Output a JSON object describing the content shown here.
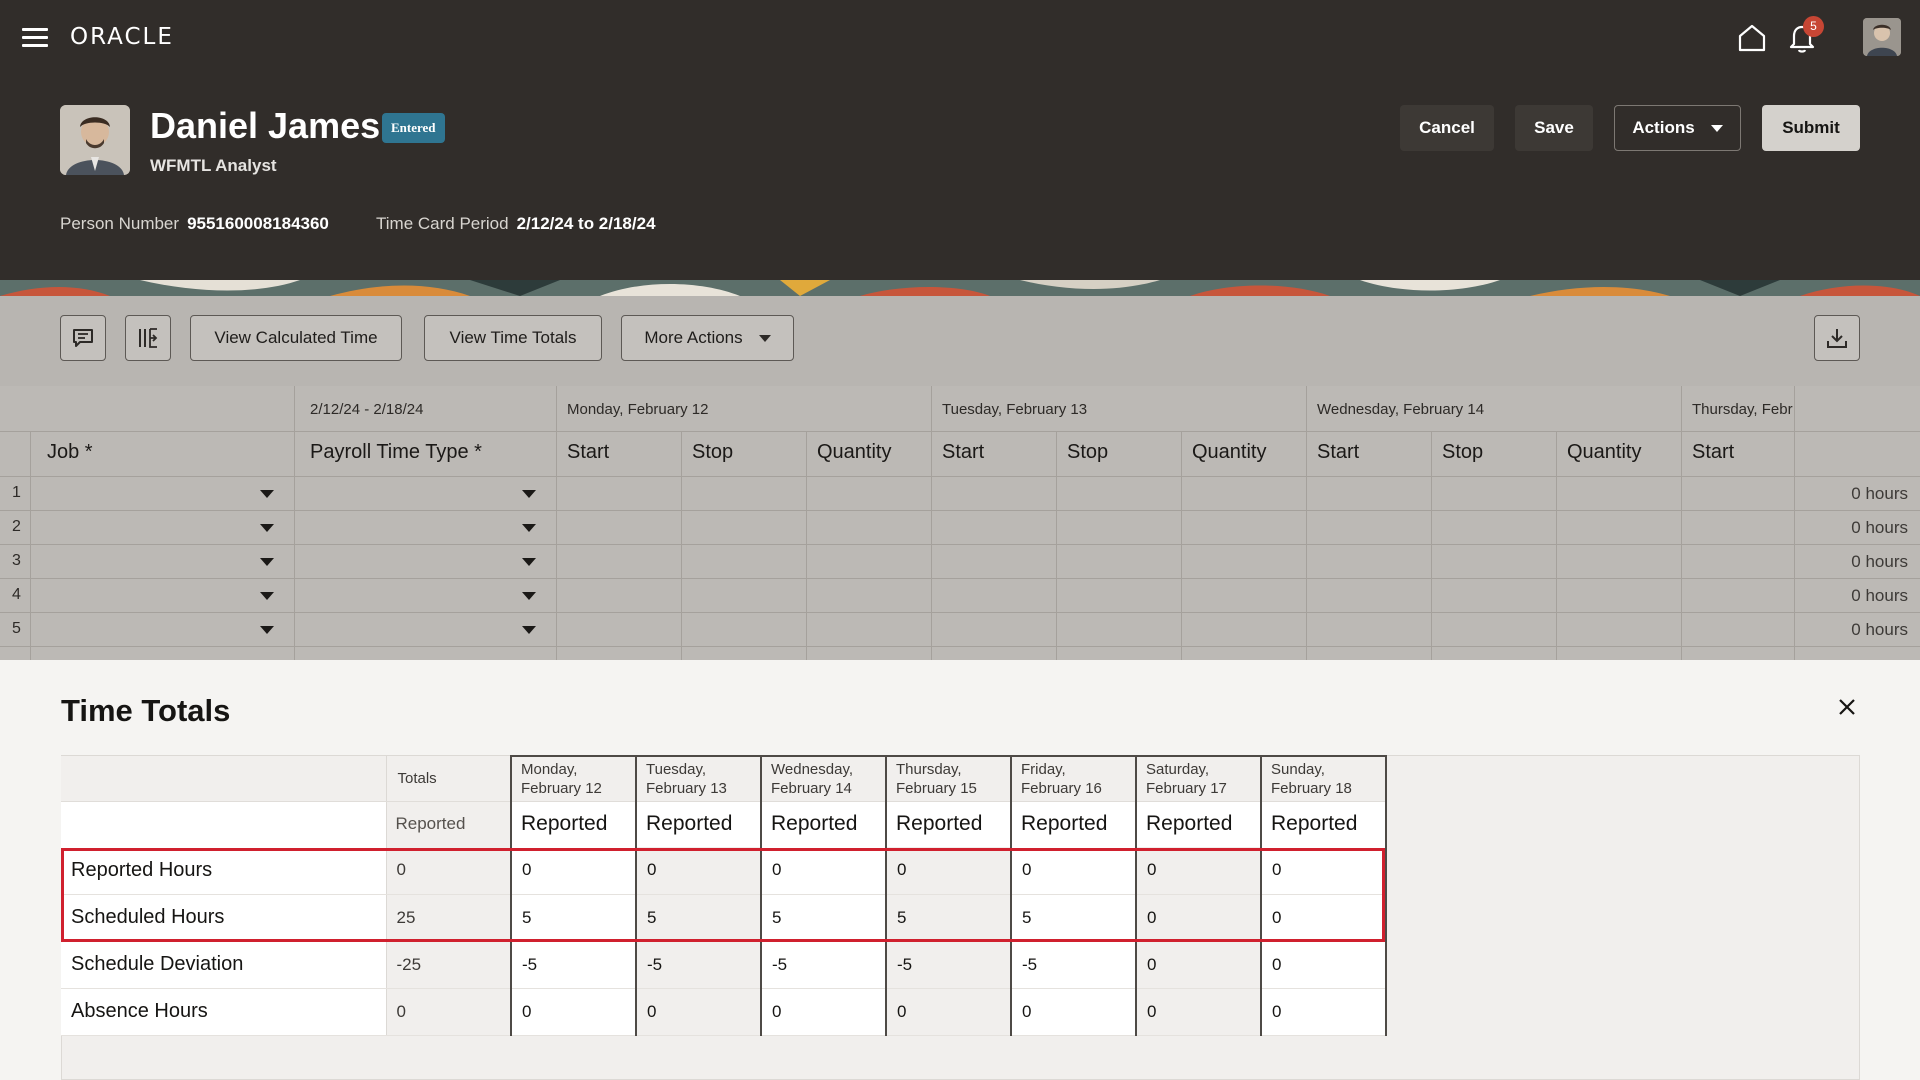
{
  "header": {
    "logo": "ORACLE",
    "notifications_count": "5",
    "person_name": "Daniel James",
    "status": "Entered",
    "role": "WFMTL Analyst",
    "person_number_label": "Person Number",
    "person_number": "955160008184360",
    "period_label": "Time Card Period",
    "period": "2/12/24 to 2/18/24",
    "buttons": {
      "cancel": "Cancel",
      "save": "Save",
      "actions": "Actions",
      "submit": "Submit"
    }
  },
  "toolbar": {
    "view_calculated_time": "View Calculated Time",
    "view_time_totals": "View Time Totals",
    "more_actions": "More Actions"
  },
  "grid": {
    "range": "2/12/24 - 2/18/24",
    "days": [
      "Monday, February 12",
      "Tuesday, February 13",
      "Wednesday, February 14",
      "Thursday, Febr"
    ],
    "columns": {
      "job": "Job *",
      "payroll": "Payroll Time Type *",
      "start": "Start",
      "stop": "Stop",
      "quantity": "Quantity"
    },
    "rows": [
      "1",
      "2",
      "3",
      "4",
      "5"
    ],
    "row_hours": "0 hours"
  },
  "time_totals": {
    "title": "Time Totals",
    "totals_label": "Totals",
    "reported_label": "Reported",
    "days": [
      [
        "Monday,",
        "February 12"
      ],
      [
        "Tuesday,",
        "February 13"
      ],
      [
        "Wednesday,",
        "February 14"
      ],
      [
        "Thursday,",
        "February 15"
      ],
      [
        "Friday,",
        "February 16"
      ],
      [
        "Saturday,",
        "February 17"
      ],
      [
        "Sunday,",
        "February 18"
      ]
    ],
    "rows": [
      {
        "label": "Reported Hours",
        "total": "0",
        "values": [
          "0",
          "0",
          "0",
          "0",
          "0",
          "0",
          "0"
        ]
      },
      {
        "label": "Scheduled Hours",
        "total": "25",
        "values": [
          "5",
          "5",
          "5",
          "5",
          "5",
          "0",
          "0"
        ]
      },
      {
        "label": "Schedule Deviation",
        "total": "-25",
        "values": [
          "-5",
          "-5",
          "-5",
          "-5",
          "-5",
          "0",
          "0"
        ]
      },
      {
        "label": "Absence Hours",
        "total": "0",
        "values": [
          "0",
          "0",
          "0",
          "0",
          "0",
          "0",
          "0"
        ]
      }
    ]
  },
  "colors": {
    "header_bg": "#312d2a",
    "badge": "#2f7591",
    "notification": "#c74634",
    "highlight": "#d0202e"
  }
}
